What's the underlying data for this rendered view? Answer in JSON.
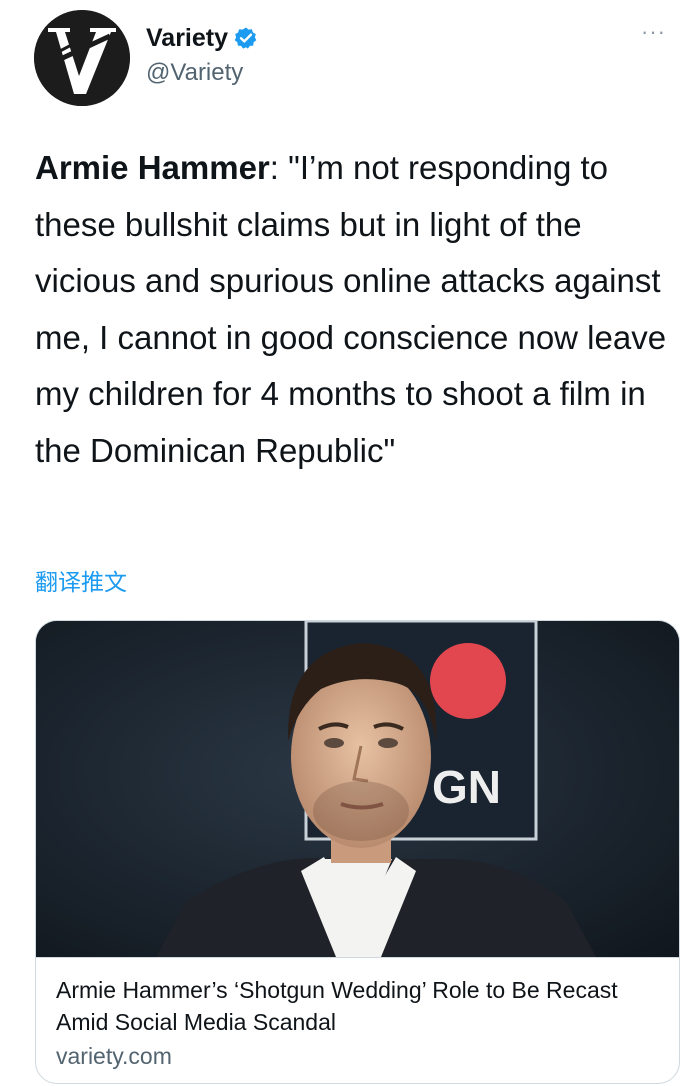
{
  "author": {
    "display_name": "Variety",
    "handle": "@Variety",
    "avatar_icon": "variety-v-logo-icon",
    "verified_icon": "verified-badge-icon",
    "verified_color": "#1d9bf0"
  },
  "menu": {
    "more_label": "···"
  },
  "tweet": {
    "speaker": "Armie Hammer",
    "body": ": \"I’m not responding to these bullshit claims but in light of the vicious and spurious online attacks against me, I cannot in good conscience now leave my children for 4 months to shoot a film in the Dominican Republic\"",
    "translate_label": "翻译推文"
  },
  "card": {
    "title": "Armie Hammer’s ‘Shotgun Wedding’ Role to Be Recast Amid Social Media Scandal",
    "domain": "variety.com",
    "backdrop_text": "GN"
  },
  "colors": {
    "link_blue": "#1d9bf0",
    "text_primary": "#0f1419",
    "text_secondary": "#536471",
    "border": "#cfd9de"
  }
}
